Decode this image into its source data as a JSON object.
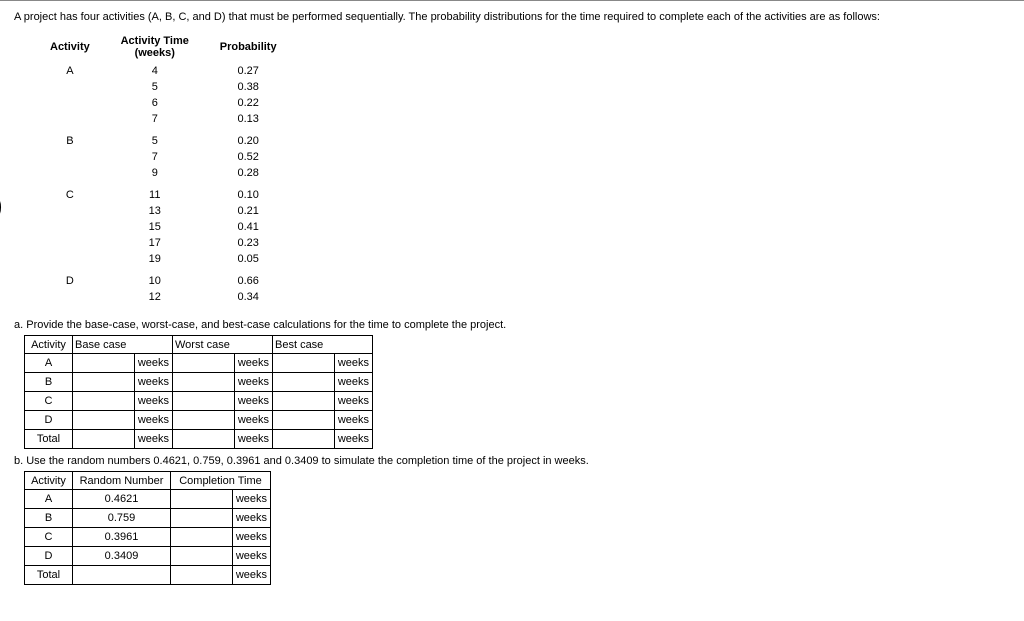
{
  "intro": "A project has four activities (A, B, C, and D) that must be performed sequentially. The probability distributions for the time required to complete each of the activities are as follows:",
  "dist_headers": {
    "activity": "Activity",
    "time": "Activity Time (weeks)",
    "prob": "Probability"
  },
  "dist_groups": [
    {
      "activity": "A",
      "rows": [
        {
          "time": "4",
          "prob": "0.27"
        },
        {
          "time": "5",
          "prob": "0.38"
        },
        {
          "time": "6",
          "prob": "0.22"
        },
        {
          "time": "7",
          "prob": "0.13"
        }
      ]
    },
    {
      "activity": "B",
      "rows": [
        {
          "time": "5",
          "prob": "0.20"
        },
        {
          "time": "7",
          "prob": "0.52"
        },
        {
          "time": "9",
          "prob": "0.28"
        }
      ]
    },
    {
      "activity": "C",
      "rows": [
        {
          "time": "11",
          "prob": "0.10"
        },
        {
          "time": "13",
          "prob": "0.21"
        },
        {
          "time": "15",
          "prob": "0.41"
        },
        {
          "time": "17",
          "prob": "0.23"
        },
        {
          "time": "19",
          "prob": "0.05"
        }
      ]
    },
    {
      "activity": "D",
      "rows": [
        {
          "time": "10",
          "prob": "0.66"
        },
        {
          "time": "12",
          "prob": "0.34"
        }
      ]
    }
  ],
  "qa": "a. Provide the base-case, worst-case, and best-case calculations for the time to complete the project.",
  "qb": "b. Use the random numbers 0.4621, 0.759, 0.3961 and 0.3409 to simulate the completion time of the project in weeks.",
  "tA": {
    "headers": {
      "activity": "Activity",
      "base": "Base case",
      "worst": "Worst case",
      "best": "Best case"
    },
    "rows": [
      "A",
      "B",
      "C",
      "D",
      "Total"
    ],
    "unit": "weeks"
  },
  "tB": {
    "headers": {
      "activity": "Activity",
      "rn": "Random Number",
      "ct": "Completion Time"
    },
    "rows": [
      {
        "act": "A",
        "rn": "0.4621"
      },
      {
        "act": "B",
        "rn": "0.759"
      },
      {
        "act": "C",
        "rn": "0.3961"
      },
      {
        "act": "D",
        "rn": "0.3409"
      },
      {
        "act": "Total",
        "rn": ""
      }
    ],
    "unit": "weeks"
  }
}
